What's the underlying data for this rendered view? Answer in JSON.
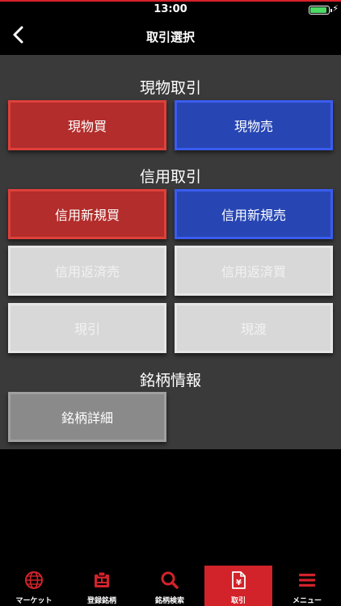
{
  "status_bar": {
    "time": "13:00"
  },
  "nav": {
    "title": "取引選択"
  },
  "sections": {
    "spot": {
      "title": "現物取引",
      "buy": "現物買",
      "sell": "現物売"
    },
    "margin": {
      "title": "信用取引",
      "new_buy": "信用新規買",
      "new_sell": "信用新規売",
      "repay_sell": "信用返済売",
      "repay_buy": "信用返済買",
      "delivery_receive": "現引",
      "delivery_give": "現渡"
    },
    "stock_info": {
      "title": "銘柄情報",
      "detail": "銘柄詳細"
    }
  },
  "tabbar": {
    "active_index": 3,
    "items": [
      {
        "label": "マーケット",
        "icon": "globe-icon"
      },
      {
        "label": "登録銘柄",
        "icon": "clipboard-icon"
      },
      {
        "label": "銘柄検索",
        "icon": "search-icon"
      },
      {
        "label": "取引",
        "icon": "yen-document-icon"
      },
      {
        "label": "メニュー",
        "icon": "menu-icon"
      }
    ]
  },
  "colors": {
    "accent_red": "#d2232a",
    "buy_red": "#b22d2b",
    "sell_blue": "#2746b3",
    "disabled_gray": "#d8d8d8",
    "panel_bg": "#3a3a3a",
    "battery_green": "#4cd964"
  }
}
